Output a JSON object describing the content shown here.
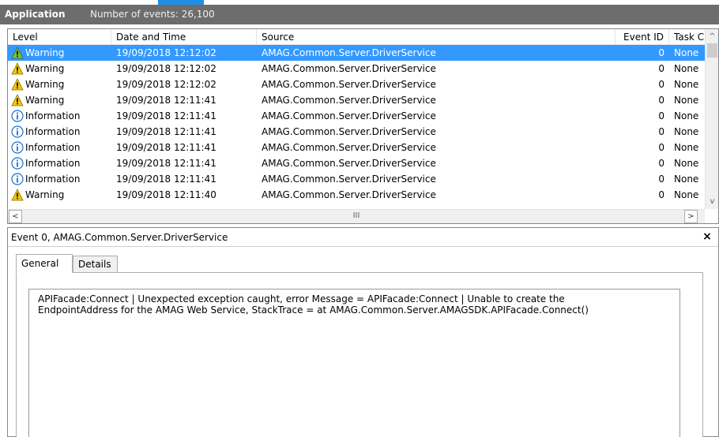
{
  "header": {
    "title": "Application",
    "event_count": "Number of events: 26,100"
  },
  "columns": {
    "level": "Level",
    "date": "Date and Time",
    "source": "Source",
    "event_id": "Event ID",
    "task": "Task C"
  },
  "rows": [
    {
      "level": "Warning",
      "icon": "warning-icon",
      "date": "19/09/2018 12:12:02",
      "source": "AMAG.Common.Server.DriverService",
      "event_id": "0",
      "task": "None",
      "selected": true
    },
    {
      "level": "Warning",
      "icon": "warning-icon",
      "date": "19/09/2018 12:12:02",
      "source": "AMAG.Common.Server.DriverService",
      "event_id": "0",
      "task": "None",
      "selected": false
    },
    {
      "level": "Warning",
      "icon": "warning-icon",
      "date": "19/09/2018 12:12:02",
      "source": "AMAG.Common.Server.DriverService",
      "event_id": "0",
      "task": "None",
      "selected": false
    },
    {
      "level": "Warning",
      "icon": "warning-icon",
      "date": "19/09/2018 12:11:41",
      "source": "AMAG.Common.Server.DriverService",
      "event_id": "0",
      "task": "None",
      "selected": false
    },
    {
      "level": "Information",
      "icon": "info-icon",
      "date": "19/09/2018 12:11:41",
      "source": "AMAG.Common.Server.DriverService",
      "event_id": "0",
      "task": "None",
      "selected": false
    },
    {
      "level": "Information",
      "icon": "info-icon",
      "date": "19/09/2018 12:11:41",
      "source": "AMAG.Common.Server.DriverService",
      "event_id": "0",
      "task": "None",
      "selected": false
    },
    {
      "level": "Information",
      "icon": "info-icon",
      "date": "19/09/2018 12:11:41",
      "source": "AMAG.Common.Server.DriverService",
      "event_id": "0",
      "task": "None",
      "selected": false
    },
    {
      "level": "Information",
      "icon": "info-icon",
      "date": "19/09/2018 12:11:41",
      "source": "AMAG.Common.Server.DriverService",
      "event_id": "0",
      "task": "None",
      "selected": false
    },
    {
      "level": "Information",
      "icon": "info-icon",
      "date": "19/09/2018 12:11:41",
      "source": "AMAG.Common.Server.DriverService",
      "event_id": "0",
      "task": "None",
      "selected": false
    },
    {
      "level": "Warning",
      "icon": "warning-icon",
      "date": "19/09/2018 12:11:40",
      "source": "AMAG.Common.Server.DriverService",
      "event_id": "0",
      "task": "None",
      "selected": false
    }
  ],
  "scroll": {
    "up": "^",
    "down": "v",
    "left": "<",
    "right": ">",
    "grip": "III"
  },
  "detail": {
    "title": "Event 0, AMAG.Common.Server.DriverService",
    "close": "×",
    "tabs": {
      "general": "General",
      "details": "Details"
    },
    "message_line1": "APIFacade:Connect | Unexpected exception caught, error Message = APIFacade:Connect | Unable to create the",
    "message_line2": "EndpointAddress for the AMAG Web Service, StackTrace =    at AMAG.Common.Server.AMAGSDK.APIFacade.Connect()"
  },
  "colors": {
    "selection": "#3399ff",
    "header_bar": "#6d6d6d",
    "warning": "#f5c400",
    "info": "#1c6fd1"
  }
}
